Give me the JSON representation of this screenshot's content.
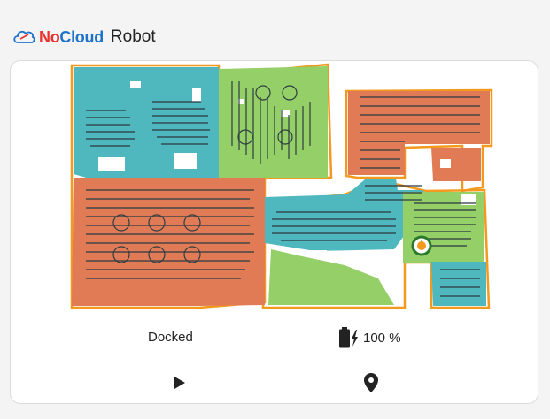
{
  "header": {
    "brand_part1": "No",
    "brand_part2": "Cloud",
    "title_suffix": "Robot",
    "icon": "cloud-icon"
  },
  "colors": {
    "room_orange": "#e07b56",
    "room_teal": "#4eb8be",
    "room_green": "#95cf68",
    "wall_orange": "#f39a1e",
    "path_dark": "#2d3c42",
    "dock_green": "#2b7a2b"
  },
  "map": {
    "icons": [
      "robot-dock-icon",
      "robot-icon"
    ]
  },
  "status": {
    "state": "Docked",
    "battery_text": "100 %",
    "battery_level": 1.0,
    "battery_icon": "battery-charging-icon"
  },
  "actions": {
    "start_icon": "play-icon",
    "locate_icon": "map-marker-icon"
  }
}
